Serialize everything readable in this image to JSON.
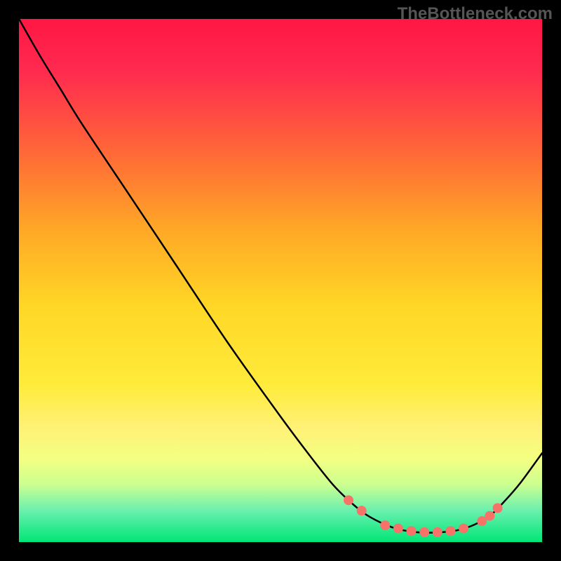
{
  "watermark": "TheBottleneck.com",
  "chart_data": {
    "type": "line",
    "title": "",
    "xlabel": "",
    "ylabel": "",
    "xlim": [
      0,
      100
    ],
    "ylim": [
      0,
      100
    ],
    "background_gradient": {
      "stops": [
        {
          "offset": 0,
          "color": "#ff1744"
        },
        {
          "offset": 10,
          "color": "#ff2a4f"
        },
        {
          "offset": 25,
          "color": "#ff6638"
        },
        {
          "offset": 40,
          "color": "#ffa726"
        },
        {
          "offset": 55,
          "color": "#ffd726"
        },
        {
          "offset": 70,
          "color": "#ffeb3b"
        },
        {
          "offset": 78,
          "color": "#fff176"
        },
        {
          "offset": 84,
          "color": "#f4ff81"
        },
        {
          "offset": 89,
          "color": "#ccff90"
        },
        {
          "offset": 94,
          "color": "#69f0ae"
        },
        {
          "offset": 100,
          "color": "#00e676"
        }
      ]
    },
    "series": [
      {
        "name": "curve",
        "type": "line",
        "color": "#000000",
        "width": 2.5,
        "points": [
          {
            "x": 0,
            "y": 100
          },
          {
            "x": 4,
            "y": 93
          },
          {
            "x": 8,
            "y": 86.5
          },
          {
            "x": 12,
            "y": 80
          },
          {
            "x": 20,
            "y": 68
          },
          {
            "x": 30,
            "y": 53
          },
          {
            "x": 40,
            "y": 38
          },
          {
            "x": 50,
            "y": 24
          },
          {
            "x": 56,
            "y": 16
          },
          {
            "x": 60,
            "y": 11
          },
          {
            "x": 63,
            "y": 8
          },
          {
            "x": 66,
            "y": 5.5
          },
          {
            "x": 69,
            "y": 3.8
          },
          {
            "x": 72,
            "y": 2.6
          },
          {
            "x": 75,
            "y": 2.0
          },
          {
            "x": 78,
            "y": 1.8
          },
          {
            "x": 81,
            "y": 1.9
          },
          {
            "x": 84,
            "y": 2.3
          },
          {
            "x": 87,
            "y": 3.3
          },
          {
            "x": 90,
            "y": 5
          },
          {
            "x": 93,
            "y": 8
          },
          {
            "x": 96,
            "y": 11.5
          },
          {
            "x": 100,
            "y": 17
          }
        ]
      }
    ],
    "markers": {
      "color": "#f77268",
      "radius": 7,
      "points": [
        {
          "x": 63,
          "y": 8
        },
        {
          "x": 65.5,
          "y": 6
        },
        {
          "x": 70,
          "y": 3.2
        },
        {
          "x": 72.5,
          "y": 2.6
        },
        {
          "x": 75,
          "y": 2.1
        },
        {
          "x": 77.5,
          "y": 1.9
        },
        {
          "x": 80,
          "y": 1.9
        },
        {
          "x": 82.5,
          "y": 2.1
        },
        {
          "x": 85,
          "y": 2.6
        },
        {
          "x": 88.5,
          "y": 4.0
        },
        {
          "x": 90,
          "y": 5.0
        },
        {
          "x": 91.5,
          "y": 6.5
        }
      ]
    }
  }
}
